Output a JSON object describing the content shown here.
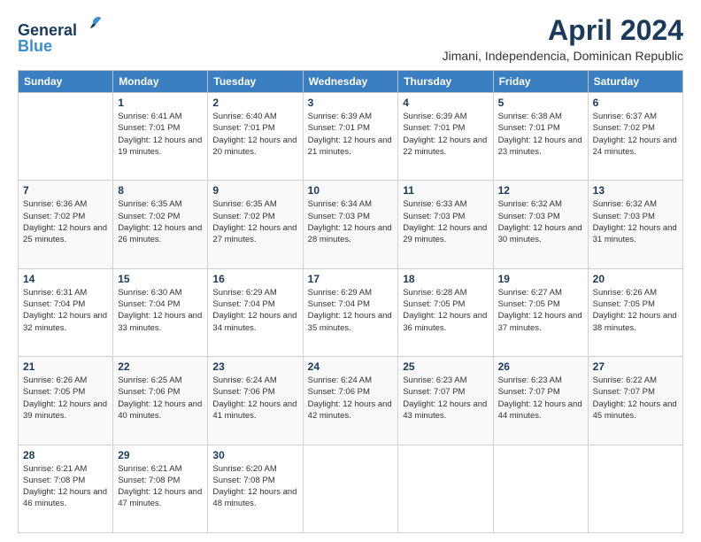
{
  "header": {
    "logo_line1": "General",
    "logo_line2": "Blue",
    "title": "April 2024",
    "subtitle": "Jimani, Independencia, Dominican Republic"
  },
  "calendar": {
    "days_of_week": [
      "Sunday",
      "Monday",
      "Tuesday",
      "Wednesday",
      "Thursday",
      "Friday",
      "Saturday"
    ],
    "weeks": [
      [
        {
          "num": "",
          "sunrise": "",
          "sunset": "",
          "daylight": "",
          "empty": true
        },
        {
          "num": "1",
          "sunrise": "Sunrise: 6:41 AM",
          "sunset": "Sunset: 7:01 PM",
          "daylight": "Daylight: 12 hours and 19 minutes."
        },
        {
          "num": "2",
          "sunrise": "Sunrise: 6:40 AM",
          "sunset": "Sunset: 7:01 PM",
          "daylight": "Daylight: 12 hours and 20 minutes."
        },
        {
          "num": "3",
          "sunrise": "Sunrise: 6:39 AM",
          "sunset": "Sunset: 7:01 PM",
          "daylight": "Daylight: 12 hours and 21 minutes."
        },
        {
          "num": "4",
          "sunrise": "Sunrise: 6:39 AM",
          "sunset": "Sunset: 7:01 PM",
          "daylight": "Daylight: 12 hours and 22 minutes."
        },
        {
          "num": "5",
          "sunrise": "Sunrise: 6:38 AM",
          "sunset": "Sunset: 7:01 PM",
          "daylight": "Daylight: 12 hours and 23 minutes."
        },
        {
          "num": "6",
          "sunrise": "Sunrise: 6:37 AM",
          "sunset": "Sunset: 7:02 PM",
          "daylight": "Daylight: 12 hours and 24 minutes."
        }
      ],
      [
        {
          "num": "7",
          "sunrise": "Sunrise: 6:36 AM",
          "sunset": "Sunset: 7:02 PM",
          "daylight": "Daylight: 12 hours and 25 minutes."
        },
        {
          "num": "8",
          "sunrise": "Sunrise: 6:35 AM",
          "sunset": "Sunset: 7:02 PM",
          "daylight": "Daylight: 12 hours and 26 minutes."
        },
        {
          "num": "9",
          "sunrise": "Sunrise: 6:35 AM",
          "sunset": "Sunset: 7:02 PM",
          "daylight": "Daylight: 12 hours and 27 minutes."
        },
        {
          "num": "10",
          "sunrise": "Sunrise: 6:34 AM",
          "sunset": "Sunset: 7:03 PM",
          "daylight": "Daylight: 12 hours and 28 minutes."
        },
        {
          "num": "11",
          "sunrise": "Sunrise: 6:33 AM",
          "sunset": "Sunset: 7:03 PM",
          "daylight": "Daylight: 12 hours and 29 minutes."
        },
        {
          "num": "12",
          "sunrise": "Sunrise: 6:32 AM",
          "sunset": "Sunset: 7:03 PM",
          "daylight": "Daylight: 12 hours and 30 minutes."
        },
        {
          "num": "13",
          "sunrise": "Sunrise: 6:32 AM",
          "sunset": "Sunset: 7:03 PM",
          "daylight": "Daylight: 12 hours and 31 minutes."
        }
      ],
      [
        {
          "num": "14",
          "sunrise": "Sunrise: 6:31 AM",
          "sunset": "Sunset: 7:04 PM",
          "daylight": "Daylight: 12 hours and 32 minutes."
        },
        {
          "num": "15",
          "sunrise": "Sunrise: 6:30 AM",
          "sunset": "Sunset: 7:04 PM",
          "daylight": "Daylight: 12 hours and 33 minutes."
        },
        {
          "num": "16",
          "sunrise": "Sunrise: 6:29 AM",
          "sunset": "Sunset: 7:04 PM",
          "daylight": "Daylight: 12 hours and 34 minutes."
        },
        {
          "num": "17",
          "sunrise": "Sunrise: 6:29 AM",
          "sunset": "Sunset: 7:04 PM",
          "daylight": "Daylight: 12 hours and 35 minutes."
        },
        {
          "num": "18",
          "sunrise": "Sunrise: 6:28 AM",
          "sunset": "Sunset: 7:05 PM",
          "daylight": "Daylight: 12 hours and 36 minutes."
        },
        {
          "num": "19",
          "sunrise": "Sunrise: 6:27 AM",
          "sunset": "Sunset: 7:05 PM",
          "daylight": "Daylight: 12 hours and 37 minutes."
        },
        {
          "num": "20",
          "sunrise": "Sunrise: 6:26 AM",
          "sunset": "Sunset: 7:05 PM",
          "daylight": "Daylight: 12 hours and 38 minutes."
        }
      ],
      [
        {
          "num": "21",
          "sunrise": "Sunrise: 6:26 AM",
          "sunset": "Sunset: 7:05 PM",
          "daylight": "Daylight: 12 hours and 39 minutes."
        },
        {
          "num": "22",
          "sunrise": "Sunrise: 6:25 AM",
          "sunset": "Sunset: 7:06 PM",
          "daylight": "Daylight: 12 hours and 40 minutes."
        },
        {
          "num": "23",
          "sunrise": "Sunrise: 6:24 AM",
          "sunset": "Sunset: 7:06 PM",
          "daylight": "Daylight: 12 hours and 41 minutes."
        },
        {
          "num": "24",
          "sunrise": "Sunrise: 6:24 AM",
          "sunset": "Sunset: 7:06 PM",
          "daylight": "Daylight: 12 hours and 42 minutes."
        },
        {
          "num": "25",
          "sunrise": "Sunrise: 6:23 AM",
          "sunset": "Sunset: 7:07 PM",
          "daylight": "Daylight: 12 hours and 43 minutes."
        },
        {
          "num": "26",
          "sunrise": "Sunrise: 6:23 AM",
          "sunset": "Sunset: 7:07 PM",
          "daylight": "Daylight: 12 hours and 44 minutes."
        },
        {
          "num": "27",
          "sunrise": "Sunrise: 6:22 AM",
          "sunset": "Sunset: 7:07 PM",
          "daylight": "Daylight: 12 hours and 45 minutes."
        }
      ],
      [
        {
          "num": "28",
          "sunrise": "Sunrise: 6:21 AM",
          "sunset": "Sunset: 7:08 PM",
          "daylight": "Daylight: 12 hours and 46 minutes."
        },
        {
          "num": "29",
          "sunrise": "Sunrise: 6:21 AM",
          "sunset": "Sunset: 7:08 PM",
          "daylight": "Daylight: 12 hours and 47 minutes."
        },
        {
          "num": "30",
          "sunrise": "Sunrise: 6:20 AM",
          "sunset": "Sunset: 7:08 PM",
          "daylight": "Daylight: 12 hours and 48 minutes."
        },
        {
          "num": "",
          "sunrise": "",
          "sunset": "",
          "daylight": "",
          "empty": true
        },
        {
          "num": "",
          "sunrise": "",
          "sunset": "",
          "daylight": "",
          "empty": true
        },
        {
          "num": "",
          "sunrise": "",
          "sunset": "",
          "daylight": "",
          "empty": true
        },
        {
          "num": "",
          "sunrise": "",
          "sunset": "",
          "daylight": "",
          "empty": true
        }
      ]
    ]
  }
}
